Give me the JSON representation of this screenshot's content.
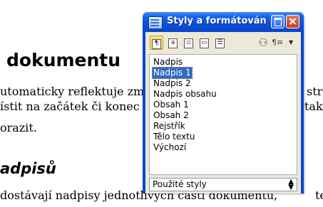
{
  "document": {
    "heading1": "dokumentu",
    "line1": "utomaticky reflektuje zm",
    "line1_tail": "str",
    "line2": "ístit na začátek či konec",
    "line2_tail": "tak",
    "line3": "orazit.",
    "heading2": "adpisů",
    "line4": "dostávají nadpisy jednotlivých částí dokumentu,",
    "line4_tail": "te"
  },
  "window": {
    "title": "Styly a formátován",
    "toolbar": {
      "paragraph_styles": "¶",
      "character_styles": "a",
      "frame_styles": "▫",
      "page_styles": "▭",
      "list_styles": "☰",
      "fill_format": "⚇",
      "new_style": "¶≡"
    },
    "styles": [
      "Nadpis",
      "Nadpis 1",
      "Nadpis 2",
      "Nadpis obsahu",
      "Obsah 1",
      "Obsah 2",
      "Rejstřík",
      "Tělo textu",
      "Výchozí"
    ],
    "selected_style": "Nadpis 1",
    "filter": "Použité styly"
  },
  "colors": {
    "titlebar": "#0b4fd8",
    "selection": "#316ac5",
    "client_bg": "#ece9d8"
  }
}
